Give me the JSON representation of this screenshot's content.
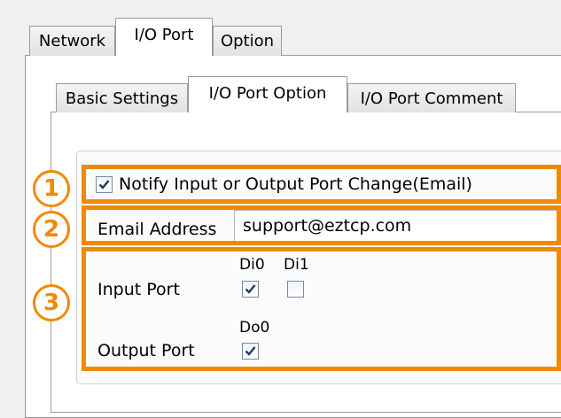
{
  "outer_tabs": [
    {
      "label": "Network",
      "active": false
    },
    {
      "label": "I/O Port",
      "active": true
    },
    {
      "label": "Option",
      "active": false
    }
  ],
  "inner_tabs": [
    {
      "label": "Basic Settings",
      "active": false
    },
    {
      "label": "I/O Port Option",
      "active": true
    },
    {
      "label": "I/O Port Comment",
      "active": false
    }
  ],
  "callout_numbers": [
    "1",
    "2",
    "3"
  ],
  "notify": {
    "label": "Notify Input or Output Port Change(Email)",
    "checked": true
  },
  "email": {
    "label": "Email Address",
    "value": "support@eztcp.com"
  },
  "input_port": {
    "label": "Input Port",
    "channels": [
      {
        "name": "Di0",
        "checked": true
      },
      {
        "name": "Di1",
        "checked": false
      }
    ]
  },
  "output_port": {
    "label": "Output Port",
    "channels": [
      {
        "name": "Do0",
        "checked": true
      }
    ]
  },
  "colors": {
    "callout": "#f08a00"
  }
}
